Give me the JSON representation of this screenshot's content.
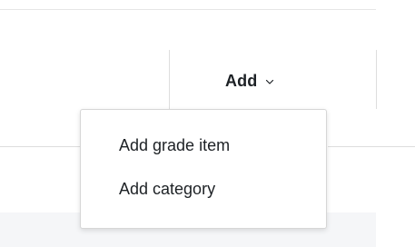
{
  "toolbar": {
    "add_label": "Add"
  },
  "icons": {
    "chevron": "chevron-down-icon"
  },
  "dropdown": {
    "items": [
      {
        "label": "Add grade item"
      },
      {
        "label": "Add category"
      }
    ]
  },
  "colors": {
    "text": "#1d2125",
    "divider": "#dddddd",
    "band": "#f5f6f8"
  }
}
